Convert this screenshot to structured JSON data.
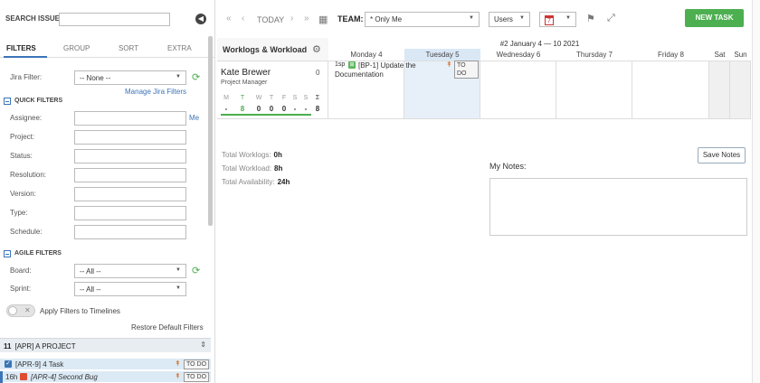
{
  "search": {
    "label": "SEARCH ISSUES:",
    "placeholder": ""
  },
  "tabs": [
    "FILTERS",
    "GROUP",
    "SORT",
    "EXTRA"
  ],
  "filters": {
    "jira_label": "Jira Filter:",
    "jira_value": "-- None --",
    "manage_link": "Manage Jira Filters",
    "quick_title": "QUICK FILTERS",
    "fields": [
      "Assignee:",
      "Project:",
      "Status:",
      "Resolution:",
      "Version:",
      "Type:",
      "Schedule:"
    ],
    "me_link": "Me",
    "agile_title": "AGILE FILTERS",
    "board_label": "Board:",
    "board_value": "-- All --",
    "sprint_label": "Sprint:",
    "sprint_value": "-- All --",
    "apply_timelines": "Apply Filters to Timelines",
    "restore": "Restore Default Filters"
  },
  "project": {
    "count": "11",
    "name": "[APR] A PROJECT"
  },
  "issues": [
    {
      "text": "[APR-9] 4 Task",
      "status": "TO DO"
    },
    {
      "est": "16h",
      "text": "[APR-4] Second Bug",
      "status": "TO DO"
    }
  ],
  "toolbar": {
    "today": "TODAY",
    "team_label": "TEAM:",
    "team_value": "* Only Me",
    "view_value": "Users",
    "calendar_day": "7",
    "new_task": "NEW TASK",
    "icons": [
      "double-chevron-left",
      "chevron-left",
      "chevron-right",
      "double-chevron-right",
      "calendar",
      "flag",
      "expand"
    ]
  },
  "calendar": {
    "header_title": "Worklogs & Workload",
    "week_range": "#2 January 4 — 10 2021",
    "days": [
      "Monday 4",
      "Tuesday 5",
      "Wednesday 6",
      "Thursday 7",
      "Friday 8",
      "Sat",
      "Sun"
    ],
    "user": {
      "name": "Kate Brewer",
      "role": "Project Manager",
      "count": "0",
      "weekday_letters": [
        "M",
        "T",
        "W",
        "T",
        "F",
        "S",
        "S",
        "Σ"
      ],
      "weekday_values": [
        "-",
        "8",
        "0",
        "0",
        "0",
        "-",
        "-",
        "8"
      ]
    },
    "card": {
      "estimate": "1sp",
      "text": "[BP-1] Update the Documentation",
      "status": "TO DO"
    }
  },
  "stats": {
    "worklogs_label": "Total Worklogs:",
    "worklogs_value": "0h",
    "workload_label": "Total Workload:",
    "workload_value": "8h",
    "availability_label": "Total Availability:",
    "availability_value": "24h"
  },
  "notes": {
    "label": "My Notes:",
    "save": "Save Notes"
  },
  "colors": {
    "accent": "#3b74b8",
    "green": "#4caf50",
    "today_bg": "#dae8f6",
    "priority": "#d86a1c"
  }
}
